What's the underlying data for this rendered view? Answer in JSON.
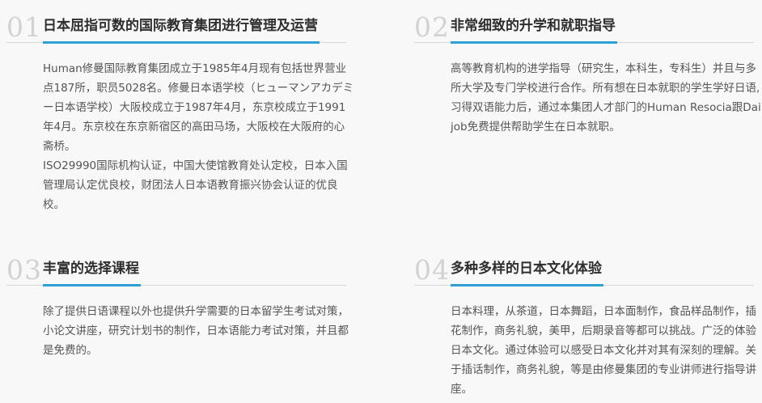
{
  "features": [
    {
      "number": "01",
      "title": "日本屈指可数的国际教育集团进行管理及运营",
      "paragraphs": [
        "Human修曼国际教育集团成立于1985年4月现有包括世界营业点187所，职员5028名。修曼日本语学校（ヒューマンアカデミー日本语学校）大阪校成立于1987年4月，东京校成立于1991年4月。东京校在东京新宿区的高田马场，大阪校在大阪府的心斋桥。",
        "ISO29990国际机构认证，中国大使馆教育处认定校，日本入国管理局认定优良校，财团法人日本语教育振兴协会认证的优良校。"
      ]
    },
    {
      "number": "02",
      "title": "非常细致的升学和就职指导",
      "paragraphs": [
        "高等教育机构的进学指导（研究生，本科生，专科生）并且与多所大学及专门学校进行合作。所有想在日本就职的学生学好日语,习得双语能力后，通过本集团人才部门的Human Resocia跟Daijob免费提供帮助学生在日本就职。"
      ]
    },
    {
      "number": "03",
      "title": "丰富的选择课程",
      "paragraphs": [
        "除了提供日语课程以外也提供升学需要的日本留学生考试对策，小论文讲座，研究计划书的制作，日本语能力考试对策，并且都是免费的。"
      ]
    },
    {
      "number": "04",
      "title": "多种多样的日本文化体验",
      "paragraphs": [
        "日本料理，从茶道，日本舞蹈，日本面制作，食品样品制作，插花制作，商务礼貌，美甲，后期录音等都可以挑战。广泛的体验日本文化。通过体验可以感受日本文化并对其有深刻的理解。关于插话制作，商务礼貌，等是由修曼集团的专业讲师进行指导讲座。"
      ]
    }
  ],
  "colors": {
    "background": "#f8f8f8",
    "accent_underline": "#2ea0d6",
    "number": "#d2d2d2",
    "title": "#2e2e2e",
    "body_text": "#555555",
    "divider": "#d6d6d6"
  }
}
